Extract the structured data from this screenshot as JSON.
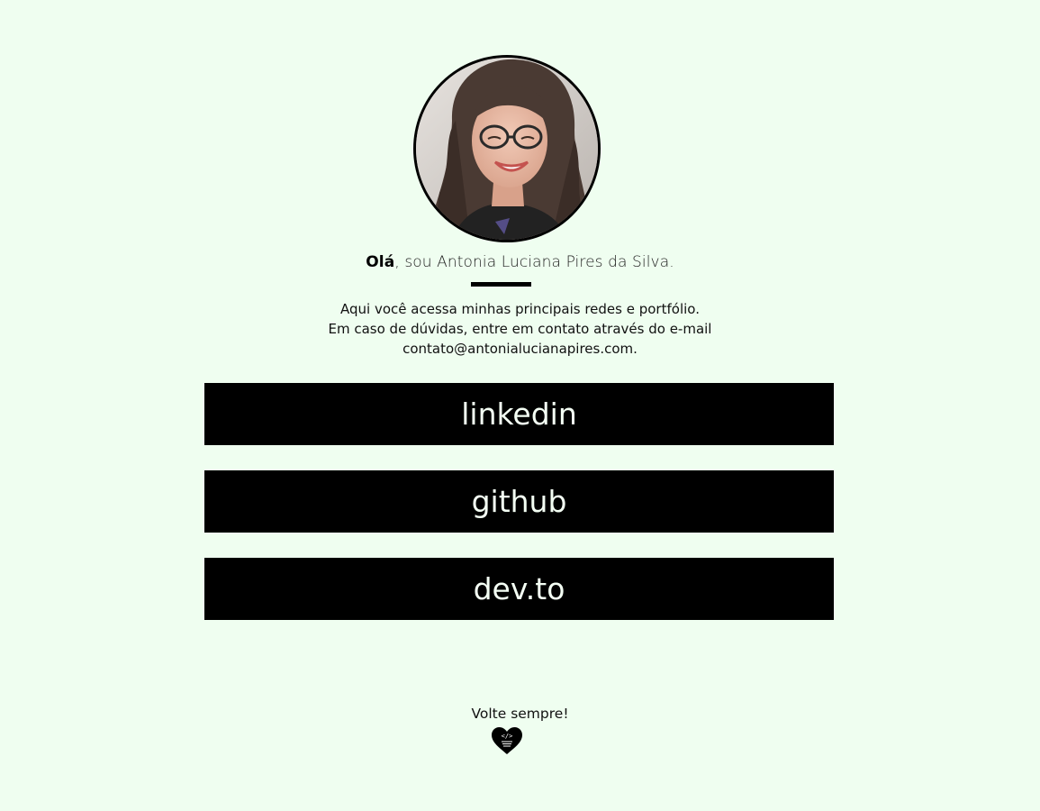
{
  "profile": {
    "photo_alt": "Foto de perfil",
    "greeting_bold": "Olá",
    "greeting_rest": ", sou Antonia Luciana Pires da Silva."
  },
  "intro": {
    "line1": "Aqui você acessa minhas principais redes e portfólio.",
    "line2": "Em caso de dúvidas, entre em contato através do e-mail",
    "line3": "contato@antonialucianapires.com."
  },
  "links": [
    {
      "label": "linkedin"
    },
    {
      "label": "github"
    },
    {
      "label": "dev.to"
    }
  ],
  "footer": {
    "text": "Volte sempre!",
    "icon": "heart-code-icon"
  },
  "colors": {
    "background": "#effef0",
    "button": "#000000",
    "button_text": "#f4fff4",
    "text": "#111111"
  }
}
